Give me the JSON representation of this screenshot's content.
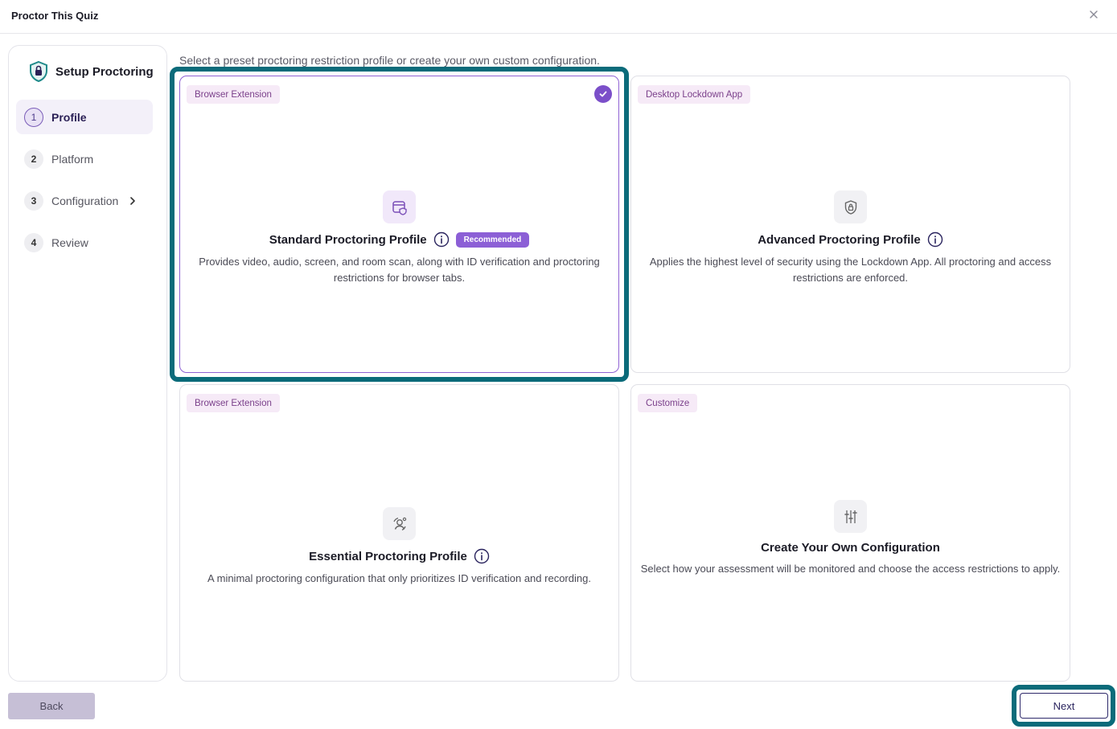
{
  "window": {
    "title": "Proctor This Quiz"
  },
  "sidebar": {
    "header": "Setup Proctoring",
    "steps": [
      {
        "num": "1",
        "label": "Profile",
        "active": true
      },
      {
        "num": "2",
        "label": "Platform"
      },
      {
        "num": "3",
        "label": "Configuration"
      },
      {
        "num": "4",
        "label": "Review"
      }
    ]
  },
  "main": {
    "instruction": "Select a preset proctoring restriction profile or create your own custom configuration.",
    "cards": [
      {
        "badge": "Browser Extension",
        "icon": "browser-shield-icon",
        "title": "Standard Proctoring Profile",
        "recommended": "Recommended",
        "description": "Provides video, audio, screen, and room scan, along with ID verification and proctoring restrictions for browser tabs.",
        "selected": true
      },
      {
        "badge": "Desktop Lockdown App",
        "icon": "lock-shield-icon",
        "title": "Advanced Proctoring Profile",
        "description": "Applies the highest level of security using the Lockdown App. All proctoring and access restrictions are enforced."
      },
      {
        "badge": "Browser Extension",
        "icon": "face-scan-icon",
        "title": "Essential Proctoring Profile",
        "description": "A minimal proctoring configuration that only prioritizes ID verification and recording."
      },
      {
        "badge": "Customize",
        "icon": "sliders-icon",
        "title": "Create Your Own Configuration",
        "description": "Select how your assessment will be monitored and choose the access restrictions to apply."
      }
    ]
  },
  "footer": {
    "back_label": "Back",
    "next_label": "Next"
  },
  "colors": {
    "accent": "#7b4fc9",
    "highlight": "#0b6b7a",
    "badge_bg": "#f6eaf7"
  }
}
